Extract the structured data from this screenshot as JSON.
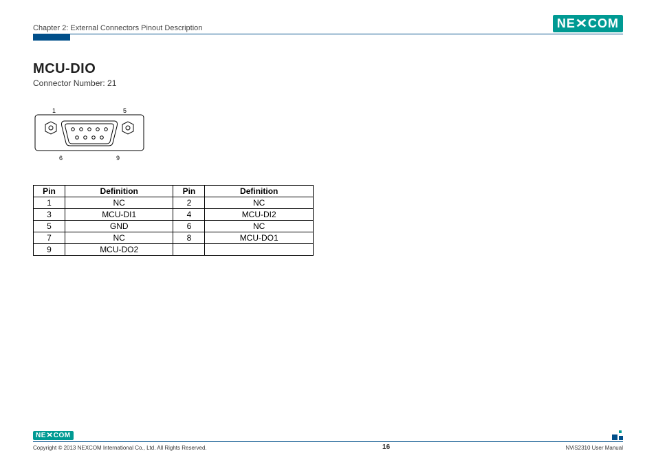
{
  "header": {
    "chapter": "Chapter 2: External Connectors Pinout Description",
    "brand": "NEXCOM"
  },
  "section": {
    "title": "MCU-DIO",
    "connector_number_label": "Connector Number: 21"
  },
  "connector_diagram": {
    "top_left_pin": "1",
    "top_right_pin": "5",
    "bottom_left_pin": "6",
    "bottom_right_pin": "9"
  },
  "table": {
    "headers": {
      "pin": "Pin",
      "definition": "Definition"
    },
    "rows": [
      {
        "pin_a": "1",
        "def_a": "NC",
        "pin_b": "2",
        "def_b": "NC"
      },
      {
        "pin_a": "3",
        "def_a": "MCU-DI1",
        "pin_b": "4",
        "def_b": "MCU-DI2"
      },
      {
        "pin_a": "5",
        "def_a": "GND",
        "pin_b": "6",
        "def_b": "NC"
      },
      {
        "pin_a": "7",
        "def_a": "NC",
        "pin_b": "8",
        "def_b": "MCU-DO1"
      },
      {
        "pin_a": "9",
        "def_a": "MCU-DO2",
        "pin_b": "",
        "def_b": ""
      }
    ]
  },
  "footer": {
    "copyright": "Copyright © 2013 NEXCOM International Co., Ltd. All Rights Reserved.",
    "page": "16",
    "doc": "NViS2310 User Manual",
    "brand": "NEXCOM"
  }
}
